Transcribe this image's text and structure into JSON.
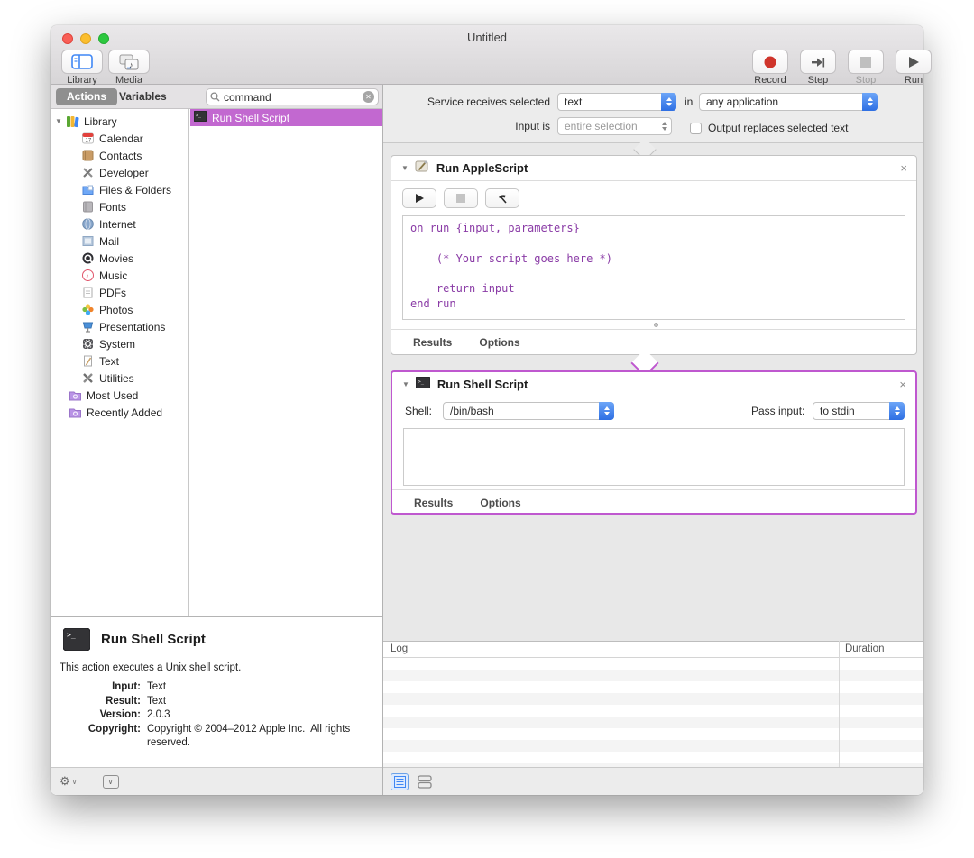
{
  "icons": {
    "disclosure": "▼",
    "close": "×",
    "gear": "⚙",
    "chevron": "∨",
    "clear": "✕"
  },
  "window": {
    "title": "Untitled"
  },
  "toolbar": {
    "library": "Library",
    "media": "Media",
    "record": "Record",
    "step": "Step",
    "stop": "Stop",
    "run": "Run"
  },
  "tabs": {
    "actions": "Actions",
    "variables": "Variables"
  },
  "search": {
    "value": "command"
  },
  "tree": {
    "root": "Library",
    "items": [
      "Calendar",
      "Contacts",
      "Developer",
      "Files & Folders",
      "Fonts",
      "Internet",
      "Mail",
      "Movies",
      "Music",
      "PDFs",
      "Photos",
      "Presentations",
      "System",
      "Text",
      "Utilities"
    ],
    "smart": [
      "Most Used",
      "Recently Added"
    ]
  },
  "action_list": {
    "selected": "Run Shell Script"
  },
  "service": {
    "receives_label": "Service receives selected",
    "receives_value": "text",
    "in_label": "in",
    "application_value": "any application",
    "input_label": "Input is",
    "input_value": "entire selection",
    "output_label": "Output replaces selected text"
  },
  "applescript": {
    "title": "Run AppleScript",
    "code": "on run {input, parameters}\n    \n    (* Your script goes here *)\n    \n    return input\nend run",
    "results": "Results",
    "options": "Options"
  },
  "shell": {
    "title": "Run Shell Script",
    "shell_label": "Shell:",
    "shell_value": "/bin/bash",
    "pass_label": "Pass input:",
    "pass_value": "to stdin",
    "results": "Results",
    "options": "Options"
  },
  "description": {
    "title": "Run Shell Script",
    "summary": "This action executes a Unix shell script.",
    "fields": [
      {
        "label": "Input:",
        "value": "Text"
      },
      {
        "label": "Result:",
        "value": "Text"
      },
      {
        "label": "Version:",
        "value": "2.0.3"
      },
      {
        "label": "Copyright:",
        "value": "Copyright © 2004–2012 Apple Inc.  All rights reserved."
      }
    ]
  },
  "log": {
    "col_log": "Log",
    "col_duration": "Duration"
  },
  "colors": {
    "selection": "#c268d0",
    "action_border": "#bf58cf",
    "dropdown_blue": "#3f87f5"
  }
}
